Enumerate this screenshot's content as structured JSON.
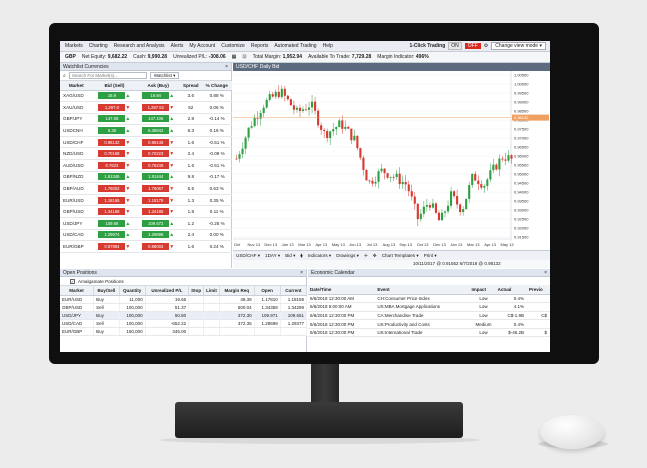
{
  "menu": {
    "items": [
      "Markets",
      "Charting",
      "Research and Analysis",
      "Alerts",
      "My Account",
      "Customize",
      "Reports",
      "Automated Trading",
      "Help"
    ],
    "one_click": "1-Click Trading",
    "on": "ON",
    "off": "OFF",
    "change_view": "Change view mode"
  },
  "account": {
    "currency": "GBP",
    "net_equity_label": "Net Equity:",
    "net_equity": "9,682.22",
    "cash_label": "Cash:",
    "cash": "9,990.28",
    "unrealized_label": "Unrealized P/L:",
    "unrealized": "-308.06",
    "total_margin_label": "Total Margin:",
    "total_margin": "1,952.94",
    "available_label": "Available To Trade:",
    "available": "7,729.28",
    "margin_ind_label": "Margin Indicator:",
    "margin_ind": "496%"
  },
  "watchlist": {
    "title": "Watchlist Currencies",
    "search_placeholder": "Search For Market(s)...",
    "button": "Watchlist",
    "headers": [
      "Market",
      "Bid (Sell)",
      "Ask (Buy)",
      "Spread",
      "% Change"
    ],
    "rows": [
      {
        "market": "XAG/USD",
        "bid": "16.9",
        "ask": "16.94",
        "spread": "3.6",
        "change": "0.88 %",
        "dir": "up"
      },
      {
        "market": "XAU/USD",
        "bid": "1,297.0",
        "ask": "1,297.52",
        "spread": "52",
        "change": "0.06 %",
        "dir": "dn"
      },
      {
        "market": "GBP/JPY",
        "bid": "147.08",
        "ask": "147.106",
        "spread": "2.8",
        "change": "-0.14 %",
        "dir": "up"
      },
      {
        "market": "USDCNH",
        "bid": "6.38",
        "ask": "6.38842",
        "spread": "6.3",
        "change": "0.16 %",
        "dir": "up"
      },
      {
        "market": "USD/CHF",
        "bid": "0.98132",
        "ask": "0.98149",
        "spread": "1.6",
        "change": "-0.51 %",
        "dir": "dn"
      },
      {
        "market": "NZD/USD",
        "bid": "0.70188",
        "ask": "0.70223",
        "spread": "2.4",
        "change": "-0.09 %",
        "dir": "dn"
      },
      {
        "market": "AUD/USD",
        "bid": "0.7623",
        "ask": "0.76249",
        "spread": "1.6",
        "change": "-0.51 %",
        "dir": "dn"
      },
      {
        "market": "GBP/NZD",
        "bid": "1.91346",
        "ask": "1.91444",
        "spread": "9.8",
        "change": "-0.17 %",
        "dir": "up"
      },
      {
        "market": "GBP/AUD",
        "bid": "1.76002",
        "ask": "1.76067",
        "spread": "5.5",
        "change": "0.63 %",
        "dir": "dn"
      },
      {
        "market": "EUR/USD",
        "bid": "1.18165",
        "ask": "1.18178",
        "spread": "1.3",
        "change": "0.35 %",
        "dir": "dn"
      },
      {
        "market": "GBP/USD",
        "bid": "1.34168",
        "ask": "1.34186",
        "spread": "1.8",
        "change": "0.11 %",
        "dir": "dn"
      },
      {
        "market": "USD/JPY",
        "bid": "109.66",
        "ask": "109.672",
        "spread": "1.2",
        "change": "-0.25 %",
        "dir": "up"
      },
      {
        "market": "USD/CAD",
        "bid": "1.29674",
        "ask": "1.29698",
        "spread": "2.4",
        "change": "0.00 %",
        "dir": "up"
      },
      {
        "market": "EUR/GBP",
        "bid": "0.87984",
        "ask": "0.88003",
        "spread": "1.6",
        "change": "0.24 %",
        "dir": "dn"
      }
    ]
  },
  "chart": {
    "title": "USD/CHF Daily Bid",
    "price_labels": [
      "1.00500",
      "1.00000",
      "0.99500",
      "0.99000",
      "0.98500",
      "0.98000",
      "0.97500",
      "0.97000",
      "0.96500",
      "0.96000",
      "0.95500",
      "0.95000",
      "0.94500",
      "0.94000",
      "0.93500",
      "0.93000",
      "0.92500",
      "0.92000",
      "0.91500"
    ],
    "current_price": "0.98132",
    "date_labels": [
      "Oct",
      "Nov 13",
      "Dec 13",
      "Jan 13",
      "Mar 13",
      "Apr 13",
      "May 13",
      "Jun 13",
      "Jul 13",
      "Aug 13",
      "Sep 13",
      "Oct 13",
      "Dec 13",
      "Jan 13",
      "Mar 13",
      "Apr 13",
      "May 13"
    ],
    "toolbar": [
      "USD/CHF",
      "1DAY",
      "Bid",
      "Indicators",
      "Drawings",
      "Chart Templates",
      "Print"
    ],
    "status": "10/11/2017 @ 0.91552    6/7/2018 @ 0.98132",
    "bull_color": "#2ea043",
    "bear_color": "#d73a31",
    "price_line_color": "#f0a060"
  },
  "positions": {
    "title": "Open Positions",
    "amalgamate": "Amalgamate Positions",
    "headers": [
      "Market",
      "Buy/Sell",
      "Quantity",
      "Unrealized P/L",
      "Stop",
      "Limit",
      "Margin Req",
      "Open",
      "Current"
    ],
    "rows": [
      {
        "market": "EUR/USD",
        "side": "Buy",
        "qty": "11,000",
        "pl": "19.66",
        "stop": "",
        "limit": "",
        "margin": "48.39",
        "open": "1.17810",
        "current": "1.18159"
      },
      {
        "market": "GBP/USD",
        "side": "Sell",
        "qty": "100,000",
        "pl": "51.37",
        "stop": "",
        "limit": "",
        "margin": "500.04",
        "open": "1.34358",
        "current": "1.34289"
      },
      {
        "market": "USD/JPY",
        "side": "Buy",
        "qty": "100,000",
        "pl": "50.80",
        "stop": "",
        "limit": "",
        "margin": "372.30",
        "open": "109.971",
        "current": "109.651"
      },
      {
        "market": "USD/CAD",
        "side": "Sell",
        "qty": "100,000",
        "pl": "-652.22",
        "stop": "",
        "limit": "",
        "margin": "372.35",
        "open": "1.28699",
        "current": "1.29377"
      },
      {
        "market": "EUR/GBP",
        "side": "Buy",
        "qty": "150,000",
        "pl": "345.00",
        "stop": "",
        "limit": "",
        "margin": "",
        "open": "",
        "current": ""
      }
    ]
  },
  "calendar": {
    "title": "Economic Calendar",
    "headers": [
      "Date/Time",
      "Event",
      "Impact",
      "Actual",
      "Previo"
    ],
    "rows": [
      {
        "date": "6/6/2018 12:30:00 AM",
        "event": "CH:Consumer Price Index",
        "impact": "Low",
        "actual": "0.4%",
        "prev": ""
      },
      {
        "date": "6/6/2018 6:00:00 AM",
        "event": "US:MBA Mortgage Applications",
        "impact": "Low",
        "actual": "4.1%",
        "prev": ""
      },
      {
        "date": "6/6/2018 12:30:00 PM",
        "event": "CA:Merchandise Trade",
        "impact": "Low",
        "actual": "C$-1.9B",
        "prev": "C$"
      },
      {
        "date": "6/6/2018 12:30:00 PM",
        "event": "US:Productivity and Costs",
        "impact": "Medium",
        "actual": "0.4%",
        "prev": ""
      },
      {
        "date": "6/6/2018 12:30:00 PM",
        "event": "US:International Trade",
        "impact": "Low",
        "actual": "$-46.2B",
        "prev": "$"
      }
    ]
  }
}
